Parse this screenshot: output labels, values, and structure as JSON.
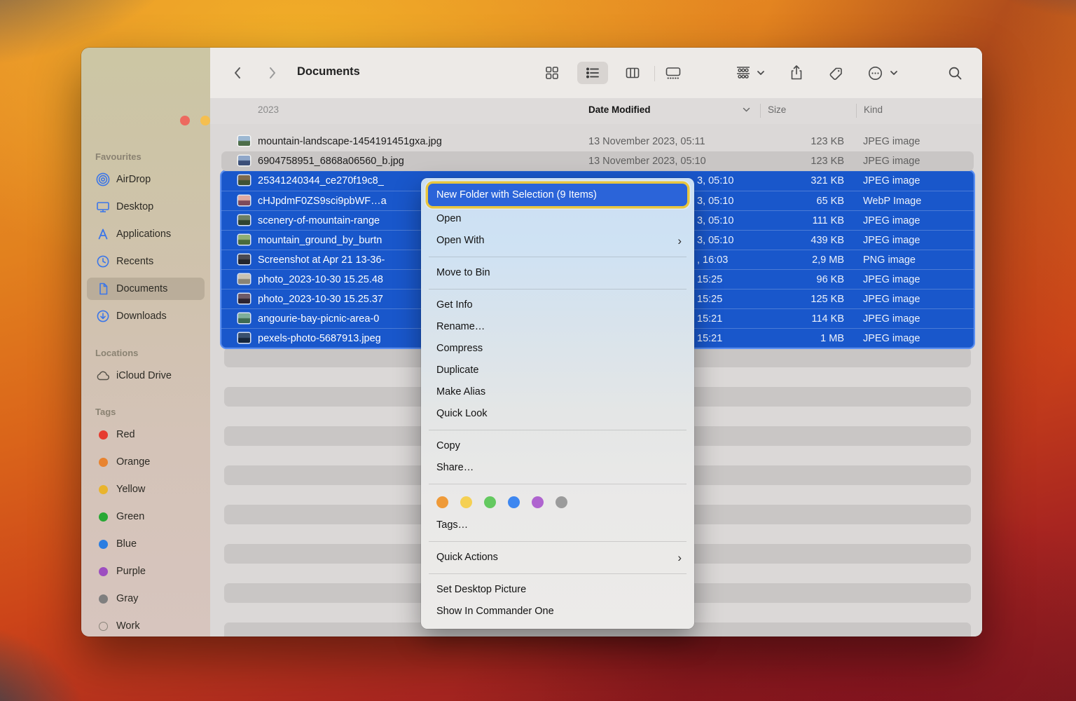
{
  "window": {
    "title": "Documents"
  },
  "toolbar": {
    "icons": [
      "back",
      "forward",
      "icon-view",
      "list-view",
      "column-view",
      "gallery-view",
      "group-by",
      "share",
      "tag",
      "more",
      "search"
    ]
  },
  "sidebar": {
    "sections": [
      {
        "label": "Favourites",
        "items": [
          {
            "label": "AirDrop"
          },
          {
            "label": "Desktop"
          },
          {
            "label": "Applications"
          },
          {
            "label": "Recents"
          },
          {
            "label": "Documents",
            "selected": true
          },
          {
            "label": "Downloads"
          }
        ]
      },
      {
        "label": "Locations",
        "items": [
          {
            "label": "iCloud Drive"
          }
        ]
      },
      {
        "label": "Tags",
        "items": [
          {
            "label": "Red",
            "color": "#e63b2f"
          },
          {
            "label": "Orange",
            "color": "#e8832f"
          },
          {
            "label": "Yellow",
            "color": "#e9b42d"
          },
          {
            "label": "Green",
            "color": "#27a834"
          },
          {
            "label": "Blue",
            "color": "#2a7de1"
          },
          {
            "label": "Purple",
            "color": "#9d4ec0"
          },
          {
            "label": "Gray",
            "color": "#7f7f7f"
          },
          {
            "label": "Work",
            "color": "hollow"
          }
        ]
      }
    ]
  },
  "list": {
    "group_label": "2023",
    "columns": {
      "date": "Date Modified",
      "size": "Size",
      "kind": "Kind"
    },
    "rows": [
      {
        "name": "mountain-landscape-1454191451gxa.jpg",
        "date": "13 November 2023, 05:11",
        "size": "123 KB",
        "kind": "JPEG image",
        "selected": false,
        "thumb": [
          "#9db8d2",
          "#4e6e4a"
        ]
      },
      {
        "name": "6904758951_6868a06560_b.jpg",
        "date": "13 November 2023, 05:10",
        "size": "123 KB",
        "kind": "JPEG image",
        "selected": false,
        "thumb": [
          "#8fa7c9",
          "#3c4f78"
        ]
      },
      {
        "name": "25341240344_ce270f19c8_",
        "date": "3, 05:10",
        "size": "321 KB",
        "kind": "JPEG image",
        "selected": true,
        "thumb": [
          "#7d6a4e",
          "#3f5233"
        ]
      },
      {
        "name": "cHJpdmF0ZS9sci9pbWF…a",
        "date": "3, 05:10",
        "size": "65 KB",
        "kind": "WebP Image",
        "selected": true,
        "thumb": [
          "#e0a9a0",
          "#7e4a5a"
        ]
      },
      {
        "name": "scenery-of-mountain-range",
        "date": "3, 05:10",
        "size": "111 KB",
        "kind": "JPEG image",
        "selected": true,
        "thumb": [
          "#6c7f63",
          "#2f4430"
        ]
      },
      {
        "name": "mountain_ground_by_burtn",
        "date": "3, 05:10",
        "size": "439 KB",
        "kind": "JPEG image",
        "selected": true,
        "thumb": [
          "#8fae72",
          "#4a6b3a"
        ]
      },
      {
        "name": "Screenshot at Apr 21 13-36-",
        "date": ", 16:03",
        "size": "2,9 MB",
        "kind": "PNG image",
        "selected": true,
        "thumb": [
          "#4a4a52",
          "#23252c"
        ]
      },
      {
        "name": "photo_2023-10-30 15.25.48",
        "date": "15:25",
        "size": "96 KB",
        "kind": "JPEG image",
        "selected": true,
        "thumb": [
          "#c9c2b2",
          "#8a8474"
        ]
      },
      {
        "name": "photo_2023-10-30 15.25.37",
        "date": "15:25",
        "size": "125 KB",
        "kind": "JPEG image",
        "selected": true,
        "thumb": [
          "#6e5a66",
          "#2e2430"
        ]
      },
      {
        "name": "angourie-bay-picnic-area-0",
        "date": "15:21",
        "size": "114 KB",
        "kind": "JPEG image",
        "selected": true,
        "thumb": [
          "#7fae9a",
          "#3e6b52"
        ]
      },
      {
        "name": "pexels-photo-5687913.jpeg",
        "date": "15:21",
        "size": "1 MB",
        "kind": "JPEG image",
        "selected": true,
        "thumb": [
          "#39506e",
          "#16263c"
        ]
      }
    ]
  },
  "menu": {
    "highlight": "New Folder with Selection (9 Items)",
    "items": [
      {
        "label": "Open"
      },
      {
        "label": "Open With",
        "submenu": true
      },
      {
        "label": "Move to Bin"
      },
      {
        "label": "Get Info"
      },
      {
        "label": "Rename…"
      },
      {
        "label": "Compress"
      },
      {
        "label": "Duplicate"
      },
      {
        "label": "Make Alias"
      },
      {
        "label": "Quick Look"
      },
      {
        "label": "Copy"
      },
      {
        "label": "Share…"
      },
      {
        "label": "Tags…"
      },
      {
        "label": "Quick Actions",
        "submenu": true
      },
      {
        "label": "Set Desktop Picture"
      },
      {
        "label": "Show In Commander One"
      }
    ],
    "dots": [
      "#ef9a38",
      "#f5d053",
      "#64c960",
      "#3e87f0",
      "#af64cf",
      "#9b9b9b"
    ]
  },
  "colors": {
    "selection_blue": "#1957cb",
    "menu_highlight_blue": "#2b64d9",
    "highlight_ring_gold": "#e9c63e",
    "sidebar_icon_blue": "#3b76e9"
  }
}
